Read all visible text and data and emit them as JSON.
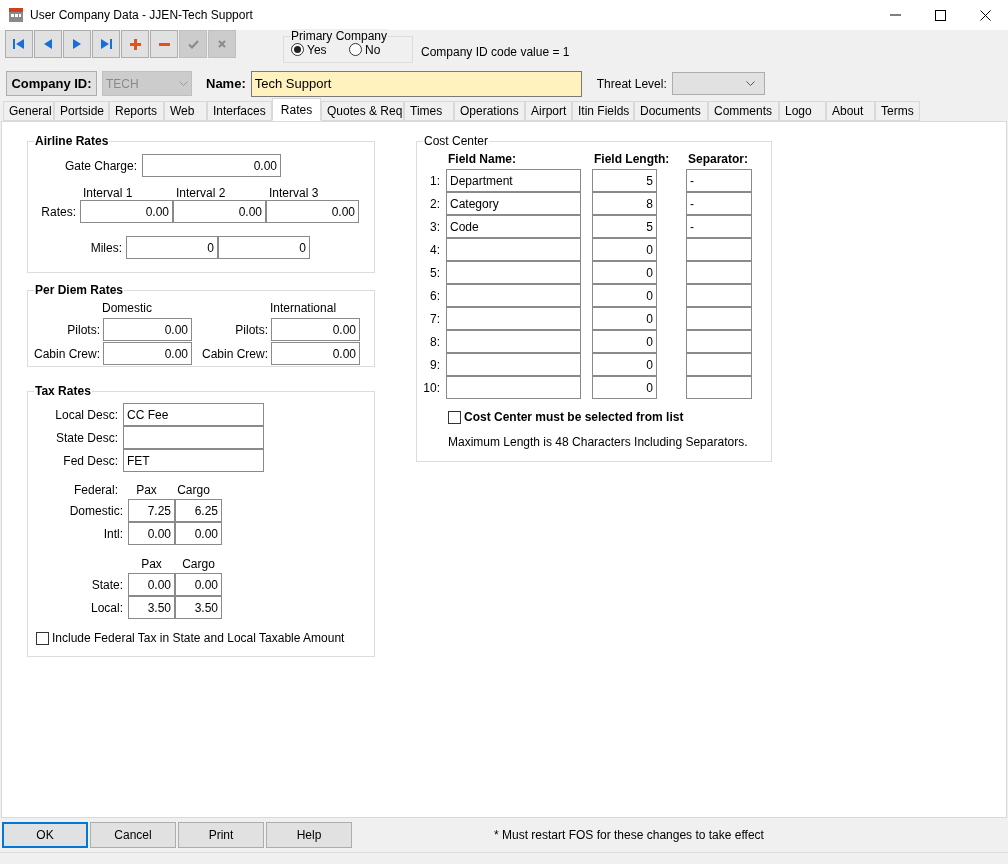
{
  "window": {
    "title": "User Company Data - JJEN-Tech Support"
  },
  "toolbar": [
    {
      "kind": "first",
      "disabled": false
    },
    {
      "kind": "previous",
      "disabled": false
    },
    {
      "kind": "next",
      "disabled": false
    },
    {
      "kind": "last",
      "disabled": false
    },
    {
      "kind": "add",
      "disabled": false
    },
    {
      "kind": "remove",
      "disabled": false
    },
    {
      "kind": "confirm",
      "disabled": true
    },
    {
      "kind": "cancel",
      "disabled": true
    }
  ],
  "primary_company": {
    "label": "Primary Company",
    "options": [
      {
        "label": "Yes",
        "selected": true
      },
      {
        "label": "No",
        "selected": false
      }
    ]
  },
  "company_id_note": "Company ID code value = 1",
  "company_id": {
    "label": "Company ID:",
    "value": "TECH",
    "disabled": true
  },
  "name": {
    "label": "Name:",
    "value": "Tech Support"
  },
  "threat_level": {
    "label": "Threat Level:"
  },
  "tabs": [
    {
      "label": "General",
      "selected": false
    },
    {
      "label": "Portside",
      "selected": false
    },
    {
      "label": "Reports",
      "selected": false
    },
    {
      "label": "Web",
      "selected": false
    },
    {
      "label": "Interfaces",
      "selected": false
    },
    {
      "label": "Rates",
      "selected": true
    },
    {
      "label": "Quotes & Req",
      "selected": false
    },
    {
      "label": "Times",
      "selected": false
    },
    {
      "label": "Operations",
      "selected": false
    },
    {
      "label": "Airport",
      "selected": false
    },
    {
      "label": "Itin Fields",
      "selected": false
    },
    {
      "label": "Documents",
      "selected": false
    },
    {
      "label": "Comments",
      "selected": false
    },
    {
      "label": "Logo",
      "selected": false
    },
    {
      "label": "About",
      "selected": false
    },
    {
      "label": "Terms",
      "selected": false
    }
  ],
  "airline_rates": {
    "title": "Airline Rates",
    "gate_charge": {
      "label": "Gate Charge:",
      "value": "0.00"
    },
    "interval_headers": [
      "Interval 1",
      "Interval 2",
      "Interval 3"
    ],
    "rates": {
      "label": "Rates:",
      "values": [
        "0.00",
        "0.00",
        "0.00"
      ]
    },
    "miles": {
      "label": "Miles:",
      "values": [
        "0",
        "0"
      ]
    }
  },
  "per_diem": {
    "title": "Per Diem Rates",
    "columns": [
      {
        "heading": "Domestic",
        "rows": [
          {
            "label": "Pilots:",
            "value": "0.00"
          },
          {
            "label": "Cabin Crew:",
            "value": "0.00"
          }
        ]
      },
      {
        "heading": "International",
        "rows": [
          {
            "label": "Pilots:",
            "value": "0.00"
          },
          {
            "label": "Cabin Crew:",
            "value": "0.00"
          }
        ]
      }
    ]
  },
  "tax_rates": {
    "title": "Tax Rates",
    "descriptions": [
      {
        "label": "Local Desc:",
        "value": "CC Fee"
      },
      {
        "label": "State Desc:"
      },
      {
        "label": "Fed Desc:",
        "value": "FET"
      }
    ],
    "federal": {
      "label": "Federal:",
      "headers": [
        "Pax",
        "Cargo"
      ],
      "rows": [
        {
          "label": "Domestic:",
          "values": [
            "7.25",
            "6.25"
          ]
        },
        {
          "label": "Intl:",
          "values": [
            "0.00",
            "0.00"
          ]
        }
      ]
    },
    "state_local": {
      "headers": [
        "Pax",
        "Cargo"
      ],
      "rows": [
        {
          "label": "State:",
          "values": [
            "0.00",
            "0.00"
          ]
        },
        {
          "label": "Local:",
          "values": [
            "3.50",
            "3.50"
          ]
        }
      ]
    },
    "include_federal": {
      "label": "Include Federal Tax in State and Local Taxable Amount",
      "checked": false
    }
  },
  "cost_center": {
    "title": "Cost Center",
    "headers": [
      "Field Name:",
      "Field Length:",
      "Separator:"
    ],
    "rows": [
      {
        "number": "1:",
        "name": "Department",
        "length": "5",
        "separator": "-"
      },
      {
        "number": "2:",
        "name": "Category",
        "length": "8",
        "separator": "-"
      },
      {
        "number": "3:",
        "name": "Code",
        "length": "5",
        "separator": "-"
      },
      {
        "number": "4:",
        "length": "0"
      },
      {
        "number": "5:",
        "length": "0"
      },
      {
        "number": "6:",
        "length": "0"
      },
      {
        "number": "7:",
        "length": "0"
      },
      {
        "number": "8:",
        "length": "0"
      },
      {
        "number": "9:",
        "length": "0"
      },
      {
        "number": "10:",
        "length": "0"
      }
    ],
    "must_select": {
      "label": "Cost Center must be selected from list",
      "checked": false
    },
    "note": "Maximum Length is 48 Characters Including Separators."
  },
  "buttons": [
    {
      "label": "OK",
      "focused": true
    },
    {
      "label": "Cancel",
      "focused": false
    },
    {
      "label": "Print",
      "focused": false
    },
    {
      "label": "Help",
      "focused": false
    }
  ],
  "footer_note": "* Must restart FOS for these changes to take effect"
}
